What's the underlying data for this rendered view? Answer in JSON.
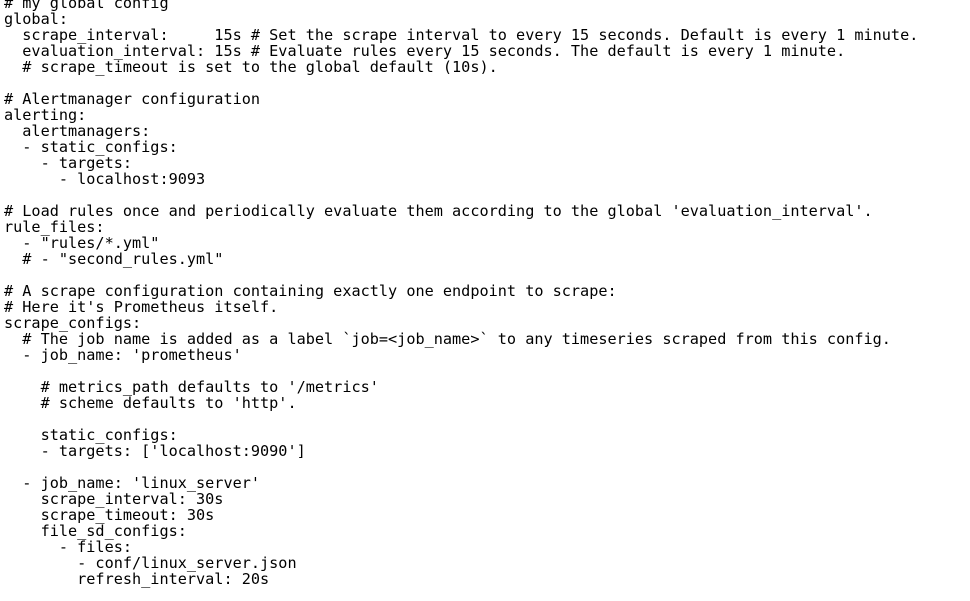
{
  "editor": {
    "lines": [
      "# my global config",
      "global:",
      "  scrape_interval:     15s # Set the scrape interval to every 15 seconds. Default is every 1 minute.",
      "  evaluation_interval: 15s # Evaluate rules every 15 seconds. The default is every 1 minute.",
      "  # scrape_timeout is set to the global default (10s).",
      "",
      "# Alertmanager configuration",
      "alerting:",
      "  alertmanagers:",
      "  - static_configs:",
      "    - targets:",
      "      - localhost:9093",
      "",
      "# Load rules once and periodically evaluate them according to the global 'evaluation_interval'.",
      "rule_files:",
      "  - \"rules/*.yml\"",
      "  # - \"second_rules.yml\"",
      "",
      "# A scrape configuration containing exactly one endpoint to scrape:",
      "# Here it's Prometheus itself.",
      "scrape_configs:",
      "  # The job name is added as a label `job=<job_name>` to any timeseries scraped from this config.",
      "  - job_name: 'prometheus'",
      "",
      "    # metrics_path defaults to '/metrics'",
      "    # scheme defaults to 'http'.",
      "",
      "    static_configs:",
      "    - targets: ['localhost:9090']",
      "",
      "  - job_name: 'linux_server'",
      "    scrape_interval: 30s",
      "    scrape_timeout: 30s",
      "    file_sd_configs:",
      "      - files:",
      "        - conf/linux_server.json",
      "        refresh_interval: 20s"
    ]
  }
}
